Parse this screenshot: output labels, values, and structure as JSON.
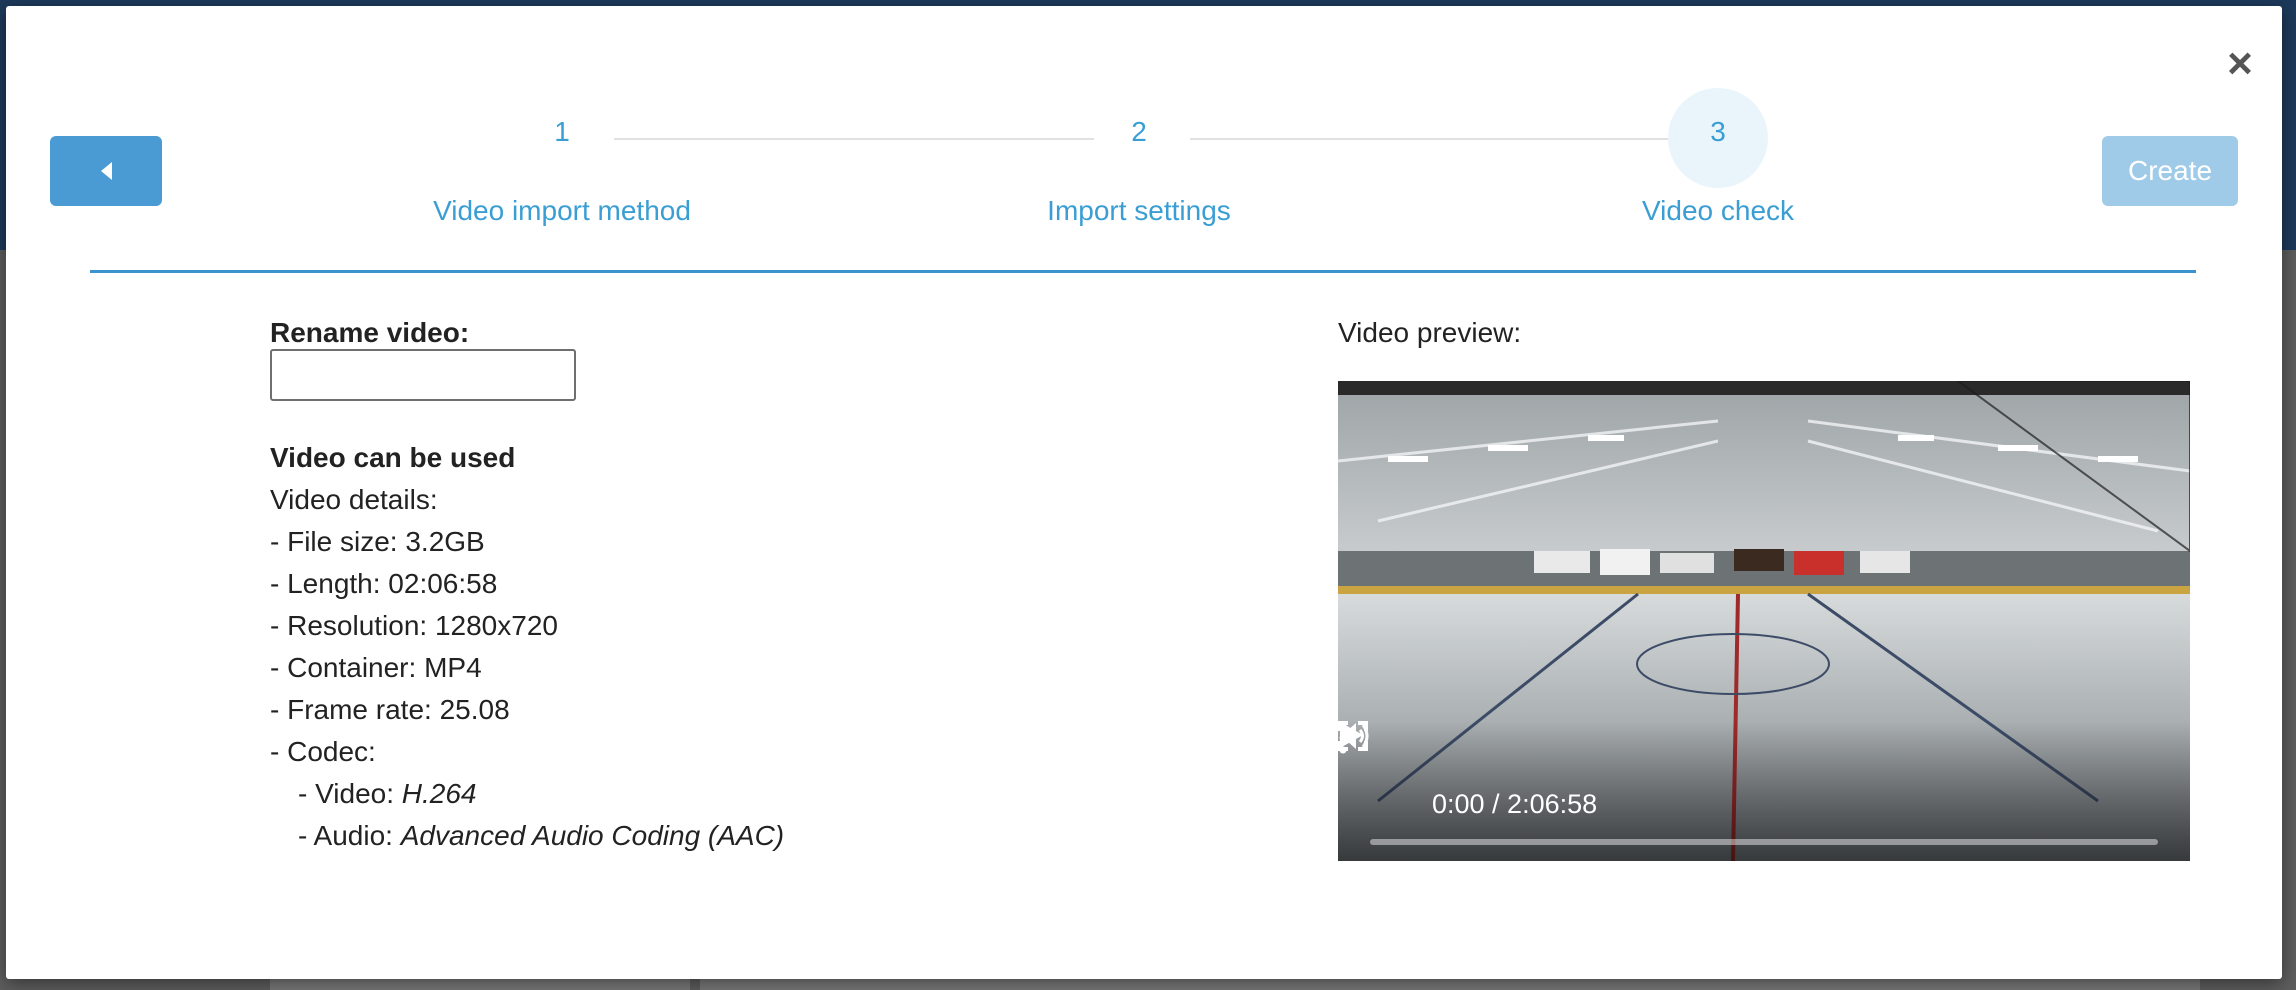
{
  "wizard": {
    "steps": [
      {
        "number": "1",
        "label": "Video import method"
      },
      {
        "number": "2",
        "label": "Import settings"
      },
      {
        "number": "3",
        "label": "Video check"
      }
    ],
    "active_step": 3,
    "create_label": "Create",
    "close_icon": "close-icon",
    "back_icon": "caret-left-icon"
  },
  "form": {
    "rename_label": "Rename video:",
    "rename_value": "",
    "status_title": "Video can be used",
    "details_title": "Video details:",
    "file_size": "- File size: 3.2GB",
    "length": "- Length: 02:06:58",
    "resolution": "- Resolution: 1280x720",
    "container": "- Container: MP4",
    "frame_rate": "- Frame rate: 25.08",
    "codec": "- Codec:",
    "video_codec_prefix": "- Video: ",
    "video_codec": "H.264",
    "audio_codec_prefix": "- Audio: ",
    "audio_codec": "Advanced Audio Coding (AAC)"
  },
  "preview": {
    "label": "Video preview:",
    "time": "0:00 / 2:06:58",
    "progress": 0,
    "icons": [
      "play-icon",
      "volume-icon",
      "fullscreen-icon",
      "more-options-icon"
    ]
  },
  "colors": {
    "accent": "#3a9ed4",
    "button": "#4a9ad3",
    "button_disabled": "#9fcbe9",
    "divider": "#3a93cf"
  }
}
